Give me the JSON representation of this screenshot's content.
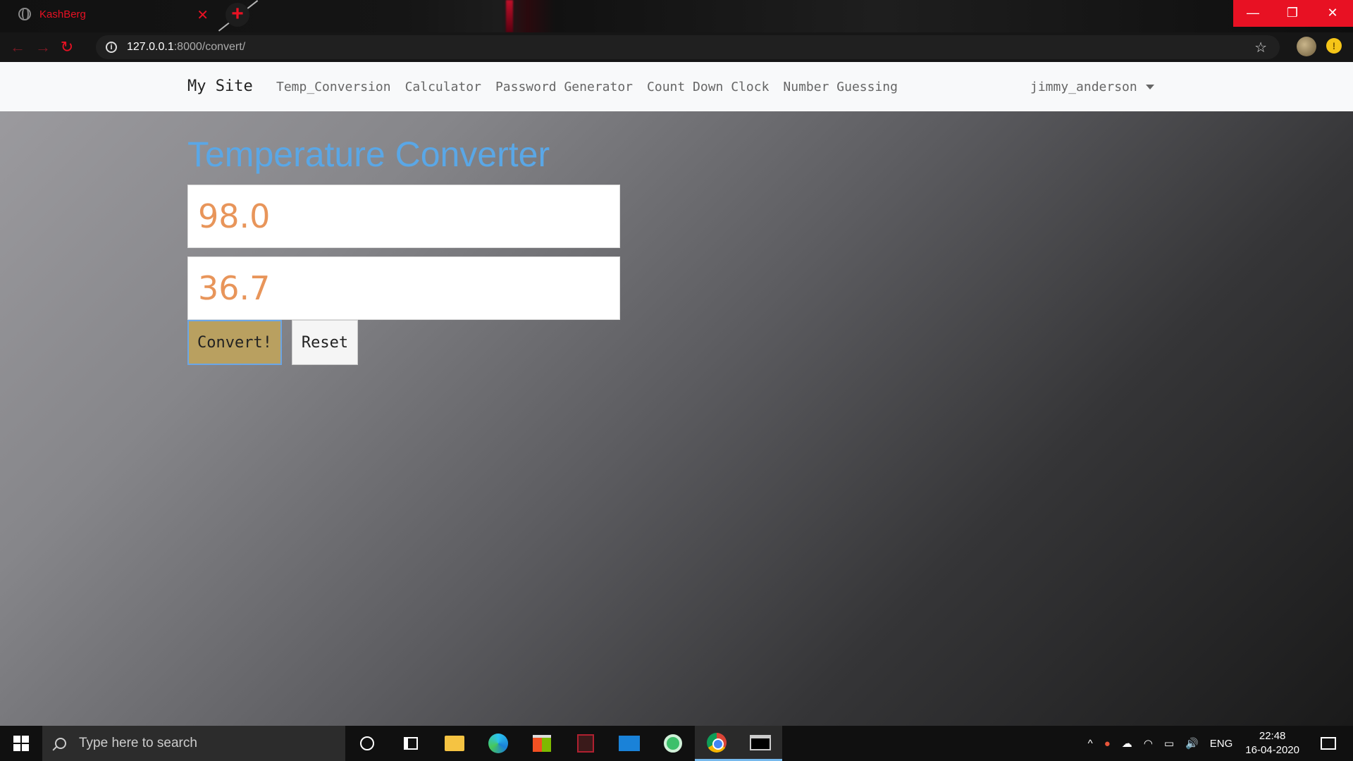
{
  "browser": {
    "tab_title": "KashBerg",
    "tab_close": "✕",
    "new_tab": "+",
    "url_host": "127.0.0.1",
    "url_rest": ":8000/convert/",
    "win_min": "—",
    "win_max": "❐",
    "win_close": "✕",
    "back": "←",
    "forward": "→",
    "reload": "↻",
    "info": "i",
    "star": "☆",
    "ext_badge": "!"
  },
  "site": {
    "brand": "My Site",
    "nav": [
      "Temp_Conversion",
      "Calculator",
      "Password Generator",
      "Count Down Clock",
      "Number Guessing"
    ],
    "user": "jimmy_anderson"
  },
  "converter": {
    "title": "Temperature Converter",
    "fahrenheit_value": "98.0",
    "celsius_value": "36.7",
    "convert_label": "Convert!",
    "reset_label": "Reset"
  },
  "taskbar": {
    "search_placeholder": "Type here to search",
    "tray_caret": "^",
    "tray_lang": "ENG",
    "tray_volume": "🔊",
    "tray_wifi": "◠",
    "tray_battery": "▭",
    "tray_cloud": "☁",
    "tray_shield": "●",
    "time": "22:48",
    "date": "16-04-2020"
  },
  "colors": {
    "accent_red": "#e81123",
    "title_blue": "#5aa7e6",
    "value_orange": "#e8955a",
    "convert_button": "#b9a060"
  }
}
